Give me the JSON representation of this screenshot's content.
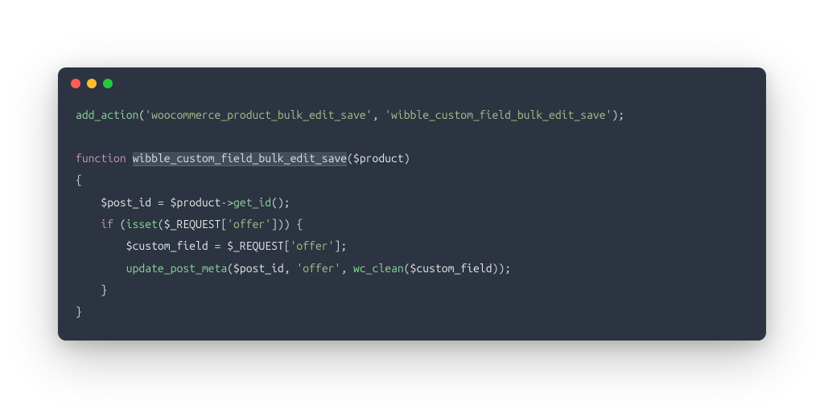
{
  "titlebar": {
    "buttons": [
      "close",
      "minimize",
      "zoom"
    ]
  },
  "code": {
    "line1": {
      "fn": "add_action",
      "arg1": "'woocommerce_product_bulk_edit_save'",
      "sep": ", ",
      "arg2": "'wibble_custom_field_bulk_edit_save'",
      "end": ");"
    },
    "line3": {
      "kw": "function",
      "space": " ",
      "name": "wibble_custom_field_bulk_edit_save",
      "params_open": "(",
      "param": "$product",
      "params_close": ")"
    },
    "line4": {
      "brace": "{"
    },
    "line5": {
      "indent": "    ",
      "var": "$post_id",
      "assign": " = ",
      "obj": "$product",
      "arrow": "->",
      "method": "get_id",
      "call": "();"
    },
    "line6": {
      "indent": "    ",
      "kw": "if",
      "open": " (",
      "fn": "isset",
      "popen": "(",
      "var": "$_REQUEST",
      "bopen": "[",
      "key": "'offer'",
      "bclose": "]",
      "pclose": ")",
      "close": ") {"
    },
    "line7": {
      "indent": "        ",
      "var": "$custom_field",
      "assign": " = ",
      "src": "$_REQUEST",
      "bopen": "[",
      "key": "'offer'",
      "bclose": "];"
    },
    "line8": {
      "indent": "        ",
      "fn": "update_post_meta",
      "popen": "(",
      "arg1": "$post_id",
      "sep1": ", ",
      "arg2": "'offer'",
      "sep2": ", ",
      "fn2": "wc_clean",
      "popen2": "(",
      "arg3": "$custom_field",
      "pclose2": ")",
      "pclose": ");"
    },
    "line9": {
      "indent": "    ",
      "brace": "}"
    },
    "line10": {
      "brace": "}"
    }
  }
}
